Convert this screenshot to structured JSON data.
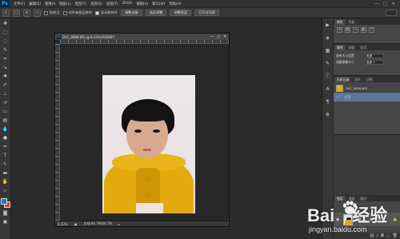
{
  "app": {
    "logo": "Ps"
  },
  "menubar": {
    "items": [
      "文件(F)",
      "编辑(E)",
      "图像(I)",
      "图层(L)",
      "类型(Y)",
      "选择(S)",
      "滤镜(T)",
      "3D(D)",
      "视图(V)",
      "窗口(W)",
      "帮助(H)"
    ],
    "win_controls": [
      "—",
      "□",
      "✕"
    ]
  },
  "optionsbar": {
    "sample_size": "取样点",
    "sample_all_layers": "对所有图层取样",
    "show_ring": "显示取样环",
    "buttons": [
      "调整边缘",
      "选区调整",
      "调整图层",
      "打开对话框"
    ]
  },
  "document": {
    "title": "DSC_0898.JPG @ 8.33%(RGB/8*)",
    "zoom": "8.33%",
    "doc_info": "文档:66.7M/66.7M",
    "controls": [
      "—",
      "□",
      "✕"
    ]
  },
  "right_panel": {
    "adjust_tabs": [
      "颜色",
      "色板"
    ],
    "properties_tabs": [
      "属性",
      "调整",
      "样式"
    ],
    "fields": [
      {
        "label": "画布大小设置",
        "value": "宽度"
      },
      {
        "label": "调整图像大小",
        "value": "高度 1"
      }
    ],
    "history_tabs": [
      "历史记录",
      "动作",
      "注释"
    ],
    "history_items": [
      {
        "label": "DSC_0898.JPG",
        "selected": false
      },
      {
        "label": "打开",
        "selected": true
      }
    ],
    "layers_tabs": [
      "图层",
      "通道",
      "路径"
    ],
    "layer": {
      "name": "背景"
    }
  },
  "watermark": {
    "brand_left": "Bai",
    "brand_right": "经验",
    "url": "jingyan.baidu.com"
  },
  "colors": {
    "accent": "#31a8ff",
    "selection": "#5e7593",
    "coat": "#e3aa0e"
  }
}
